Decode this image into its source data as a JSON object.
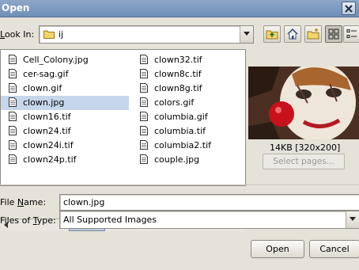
{
  "window": {
    "title": "Open"
  },
  "look_in": {
    "label": "Look In:",
    "value": "ij"
  },
  "files": {
    "column1": [
      "Cell_Colony.jpg",
      "cer-sag.gif",
      "clown.gif",
      "clown.jpg",
      "clown16.tif",
      "clown24.tif",
      "clown24i.tif",
      "clown24p.tif"
    ],
    "column2": [
      "clown32.tif",
      "clown8c.tif",
      "clown8g.tif",
      "colors.gif",
      "columbia.gif",
      "columbia.tif",
      "columbia2.tif",
      "couple.jpg"
    ],
    "selected": "clown.jpg"
  },
  "preview": {
    "size_text": "14KB [320x200]",
    "select_pages_label": "Select pages..."
  },
  "file_name": {
    "label": "File Name:",
    "value": "clown.jpg"
  },
  "files_of_type": {
    "label": "Files of Type:",
    "value": "All Supported Images"
  },
  "buttons": {
    "open": "Open",
    "cancel": "Cancel"
  },
  "icons": {
    "close": "close-icon",
    "folder": "folder-icon",
    "up": "up-folder-icon",
    "home": "home-icon",
    "new_folder": "new-folder-icon",
    "list_view": "list-view-icon",
    "details_view": "details-view-icon",
    "file": "file-icon"
  }
}
